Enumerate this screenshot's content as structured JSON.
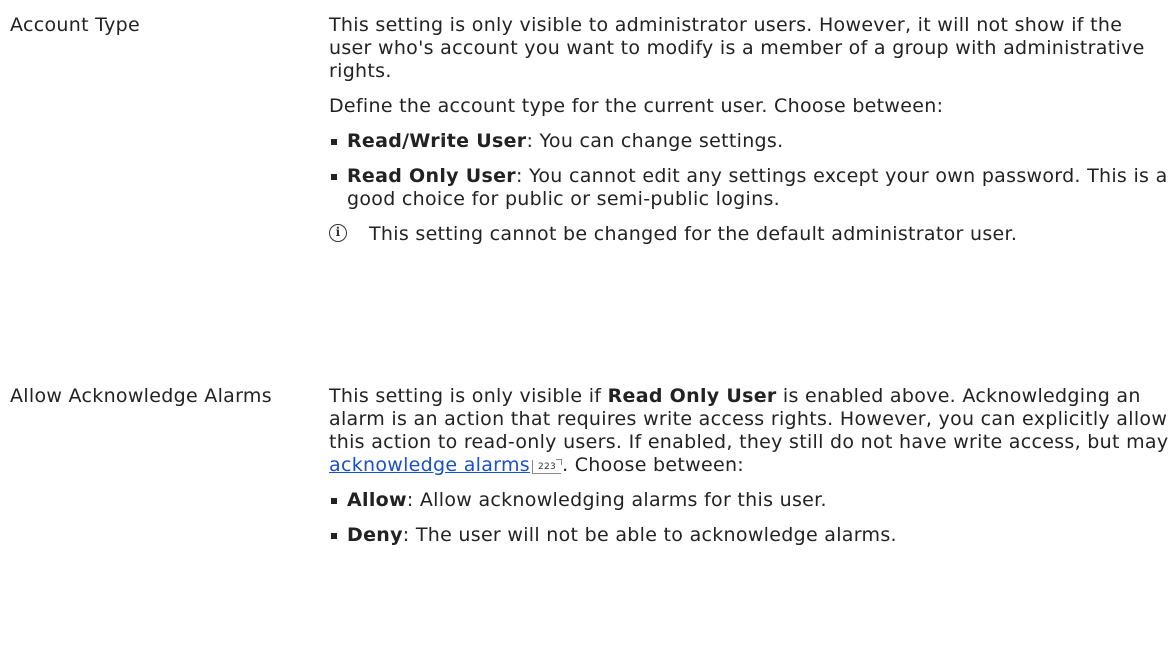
{
  "sections": {
    "account_type": {
      "label": "Account Type",
      "intro": "This setting is only visible to administrator users. However, it will not show if the user who's account you want to modify is a member of a group with administrative rights.",
      "choose": "Define the account type for the current user. Choose between:",
      "options": [
        {
          "term": "Read/Write User",
          "desc": ": You can change settings."
        },
        {
          "term": "Read Only User",
          "desc": ": You cannot edit any settings except your own password. This is a good choice for public or semi-public logins."
        }
      ],
      "note": "This setting cannot be changed for the default administrator user."
    },
    "allow_ack": {
      "label": "Allow Acknowledge Alarms",
      "text_1": "This setting is only visible if ",
      "text_bold": "Read Only User",
      "text_2": " is enabled above. Acknowledging an alarm is an action that requires write access rights. However, you can explicitly allow this action to read-only users. If enabled, they still do not have write access, but may ",
      "link_text": "acknowledge alarms",
      "page_ref": "223",
      "text_3": ". Choose between:",
      "options": [
        {
          "term": "Allow",
          "desc": ": Allow acknowledging alarms for this user."
        },
        {
          "term": "Deny",
          "desc": ": The user will not be able to acknowledge alarms."
        }
      ]
    }
  },
  "icons": {
    "info": "info-icon",
    "info_glyph": "i"
  },
  "colors": {
    "link": "#1a4fc9",
    "text": "#222222"
  }
}
